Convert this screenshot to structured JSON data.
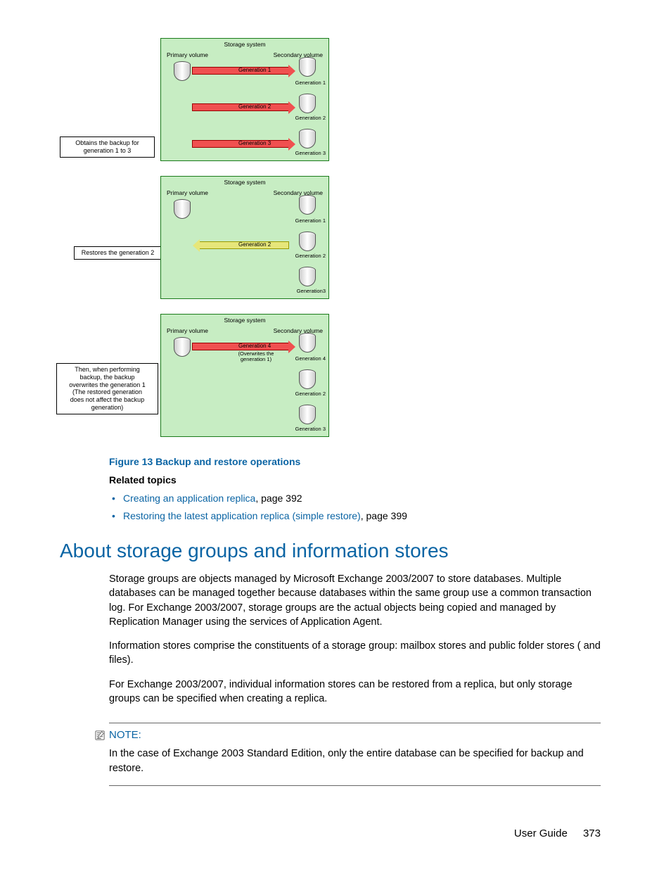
{
  "diagrams": {
    "storage_system": "Storage system",
    "primary_volume": "Primary volume",
    "secondary_volume": "Secondary volume",
    "gen1": "Generation 1",
    "gen2": "Generation 2",
    "gen3": "Generation 3",
    "gen4": "Generation 4",
    "gen3_alt": "Generation3",
    "d1_caption": "Obtains the backup for\ngeneration 1 to 3",
    "d2_caption": "Restores the generation 2",
    "d3_caption": "Then, when performing\nbackup, the backup\noverwrites the generation 1\n(The restored generation\ndoes not affect the backup\ngeneration)",
    "d3_overwrite": "(Overwrites the\ngeneration 1)"
  },
  "figure_caption": "Figure 13 Backup and restore operations",
  "related_heading": "Related topics",
  "related": [
    {
      "link": "Creating an application replica",
      "suffix": ", page 392"
    },
    {
      "link": "Restoring the latest application replica (simple restore)",
      "suffix": ", page 399"
    }
  ],
  "section_heading": "About storage groups and information stores",
  "paragraphs": {
    "p1": "Storage groups are objects managed by Microsoft Exchange 2003/2007 to store databases. Multiple databases can be managed together because databases within the same group use a common transaction log. For Exchange 2003/2007, storage groups are the actual objects being copied and managed by Replication Manager using the services of Application Agent.",
    "p2": "Information stores comprise the constituents of a storage group: mailbox stores and public folder stores (           and            files).",
    "p3": "For Exchange 2003/2007, individual information stores can be restored from a replica, but only storage groups can be specified when creating a replica."
  },
  "note": {
    "label": "NOTE:",
    "text": "In the case of Exchange 2003 Standard Edition, only the entire database can be specified for backup and restore."
  },
  "footer": {
    "doc": "User Guide",
    "page": "373"
  }
}
